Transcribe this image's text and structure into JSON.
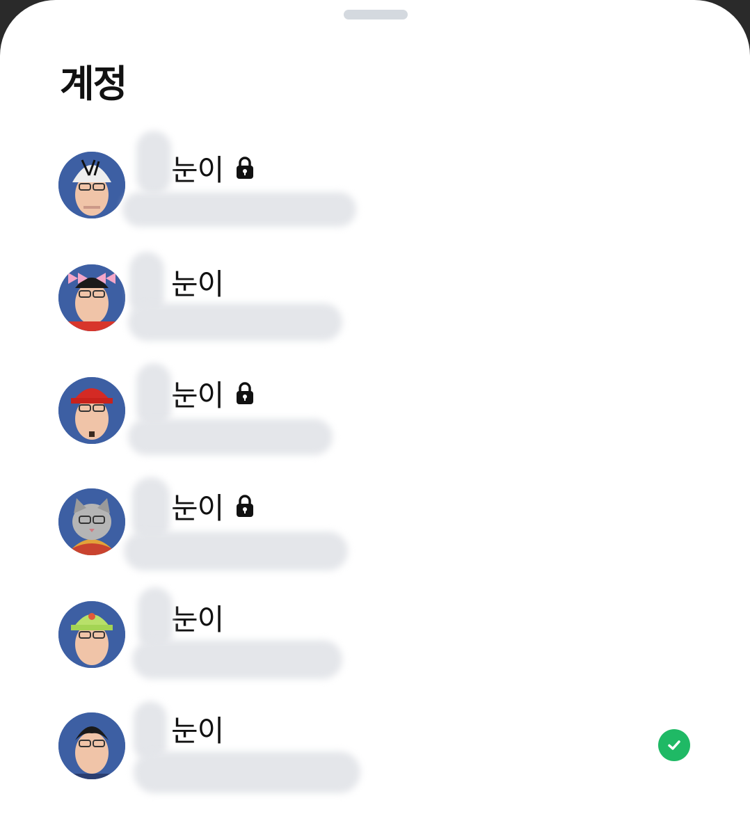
{
  "sheet": {
    "title": "계정"
  },
  "accounts": [
    {
      "name": "눈이",
      "locked": true,
      "selected": false,
      "avatar": "avatar-white-cap"
    },
    {
      "name": "눈이",
      "locked": false,
      "selected": false,
      "avatar": "avatar-pink-bows"
    },
    {
      "name": "눈이",
      "locked": true,
      "selected": false,
      "avatar": "avatar-red-cap"
    },
    {
      "name": "눈이",
      "locked": true,
      "selected": false,
      "avatar": "avatar-cat-face"
    },
    {
      "name": "눈이",
      "locked": false,
      "selected": false,
      "avatar": "avatar-green-cap"
    },
    {
      "name": "눈이",
      "locked": false,
      "selected": true,
      "avatar": "avatar-plain"
    }
  ],
  "colors": {
    "accent_check": "#1fb965",
    "avatar_bg": "#3d5fa3"
  }
}
